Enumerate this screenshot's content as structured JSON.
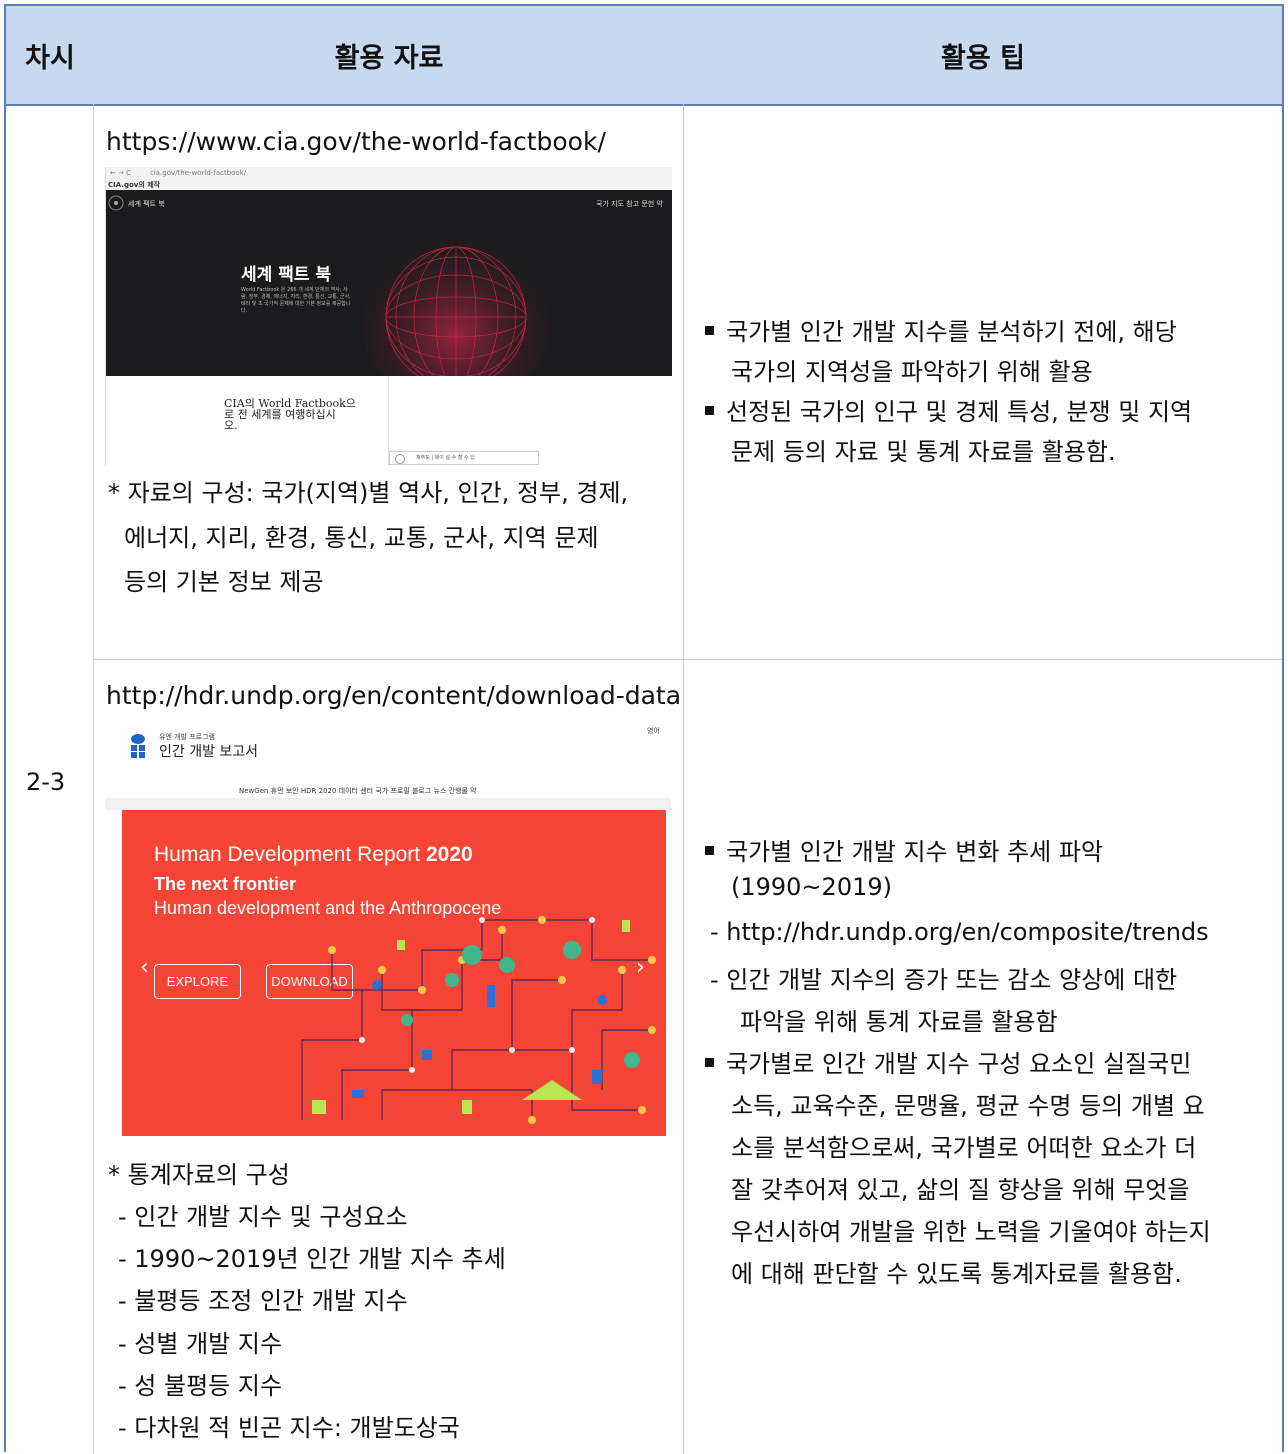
{
  "header": {
    "col1": "차시",
    "col2": "활용 자료",
    "col3": "활용 팁"
  },
  "session": "2-3",
  "row1": {
    "url": "https://www.cia.gov/the-world-factbook/",
    "shot": {
      "address": "cia.gov/the-world-factbook/",
      "tab": "CIA.gov의 제작",
      "brand": "세계 팩트 북",
      "nav": "국가  지도  참고 문헌  약",
      "title": "세계 팩트 북",
      "desc1": "World Factbook 은 266 개 세계 단체의 역사, 사",
      "desc2": "람, 정부, 경제, 에너지, 지리, 환경, 통신, 교통, 군사,",
      "desc3": "테러 및 초 국가적 문제에 대한 기본 정보를 제공합니",
      "desc4": "다.",
      "tagline1": "CIA의 World Factbook으",
      "tagline2": "로 전 세계를 여행하십시",
      "tagline3": "오.",
      "footer": "재주도 | 에이 살 수 할 수 있"
    },
    "note_lines": [
      "* 자료의 구성: 국가(지역)별 역사, 인간, 정부, 경제,",
      "에너지, 지리, 환경, 통신, 교통, 군사, 지역 문제",
      "등의 기본 정보 제공"
    ],
    "tips": [
      {
        "line1": "국가별 인간 개발 지수를 분석하기 전에, 해당",
        "line2": "국가의 지역성을 파악하기 위해 활용"
      },
      {
        "line1": "선정된 국가의 인구 및 경제 특성, 분쟁 및 지역",
        "line2": "문제 등의 자료 및 통계 자료를 활용함."
      }
    ]
  },
  "row2": {
    "url": "http://hdr.undp.org/en/content/download-data",
    "shot": {
      "org": "유엔 개발 프로그램",
      "site": "인간 개발 보고서",
      "lang": "영어",
      "nav": "NewGen 휴먼 보안    HDR 2020    데이터 센터    국가 프로필    블로그    뉴스    간행물    약",
      "headline_a": "Human Development Report ",
      "headline_b": "2020",
      "sub1": "The next frontier",
      "sub2": "Human development and the Anthropocene",
      "btn_explore": "EXPLORE",
      "btn_download": "DOWNLOAD"
    },
    "note_title": "* 통계자료의 구성",
    "note_items": [
      "- 인간 개발 지수 및 구성요소",
      "- 1990~2019년 인간 개발 지수 추세",
      "- 불평등 조정 인간 개발 지수",
      "- 성별 개발 지수",
      "- 성 불평등 지수",
      "- 다차원 적 빈곤 지수: 개발도상국"
    ],
    "tips": {
      "t1_line1": "국가별  인간  개발  지수  변화  추세  파악",
      "t1_line2": "(1990~2019)",
      "d1": "- http://hdr.undp.org/en/composite/trends",
      "d2_line1": "- 인간 개발 지수의 증가 또는 감소 양상에 대한",
      "d2_line2": "파악을 위해 통계 자료를 활용함",
      "t2_lines": [
        "국가별로 인간 개발 지수 구성 요소인 실질국민",
        "소득, 교육수준, 문맹율, 평균 수명 등의 개별 요",
        "소를 분석함으로써, 국가별로 어떠한 요소가 더",
        "잘 갖추어져 있고, 삶의 질 향상을 위해 무엇을",
        "우선시하여 개발을 위한 노력을 기울여야 하는지",
        "에 대해 판단할 수 있도록 통계자료를 활용함."
      ]
    }
  },
  "colors": {
    "header_bg": "#c8d9ef",
    "border": "#5b7fb3",
    "report_red": "#f64436"
  }
}
